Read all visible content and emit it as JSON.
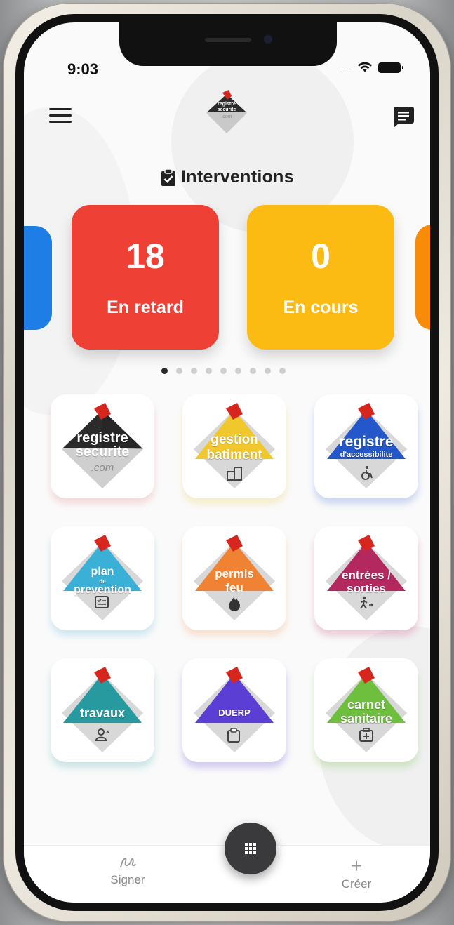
{
  "status_bar": {
    "time": "9:03",
    "signal_glyph": "....",
    "wifi_icon": "wifi-icon",
    "battery_icon": "battery-icon"
  },
  "header": {
    "menu_icon": "hamburger-menu-icon",
    "logo_text": [
      "registre",
      "securite",
      ".com"
    ],
    "chat_icon": "chat-icon"
  },
  "section": {
    "icon": "clipboard-check-icon",
    "title": "Interventions"
  },
  "cards": [
    {
      "value": "18",
      "label": "En retard",
      "color": "#ef4035"
    },
    {
      "value": "0",
      "label": "En cours",
      "color": "#fcbb12"
    }
  ],
  "peek_colors": {
    "left": "#1e7ee6",
    "right": "#f88c09"
  },
  "pager": {
    "count": 9,
    "active": 0
  },
  "apps": [
    {
      "lines": [
        "registre",
        "securite"
      ],
      "sub": ".com",
      "color": "#2b2b2b",
      "icon": ""
    },
    {
      "lines": [
        "gestion",
        "batiment"
      ],
      "color": "#f0c72c",
      "icon": "building-icon"
    },
    {
      "lines": [
        "registre"
      ],
      "sub": "d'accessibilite",
      "color": "#2457c9",
      "icon": "wheelchair-icon"
    },
    {
      "lines": [
        "plan"
      ],
      "small": "de",
      "lines2": [
        "prevention"
      ],
      "color": "#3ab0d6",
      "icon": "checklist-icon"
    },
    {
      "lines": [
        "permis",
        "feu"
      ],
      "color": "#f08233",
      "icon": "flame-icon"
    },
    {
      "lines": [
        "entrées /",
        "sorties"
      ],
      "color": "#b3285e",
      "icon": "walking-person-icon"
    },
    {
      "lines": [
        "travaux"
      ],
      "color": "#279aa0",
      "icon": "worker-icon"
    },
    {
      "lines": [
        "DUERP"
      ],
      "color": "#5b3fd4",
      "icon": "clipboard-icon"
    },
    {
      "lines": [
        "carnet",
        "sanitaire"
      ],
      "color": "#6fbf3e",
      "icon": "first-aid-icon"
    }
  ],
  "bottom_nav": {
    "sign_label": "Signer",
    "sign_icon": "signature-icon",
    "create_label": "Créer",
    "create_glyph": "+",
    "center_icon": "grid-icon"
  }
}
